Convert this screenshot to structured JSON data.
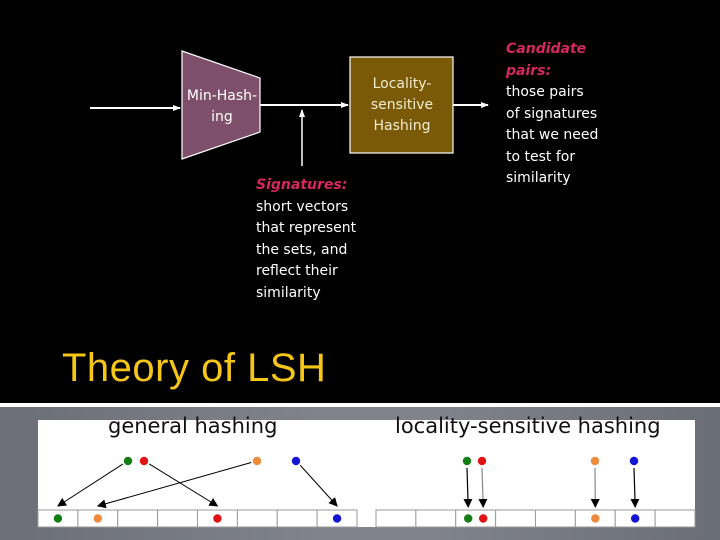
{
  "diagram": {
    "min_hashing_label_lines": [
      "Min-Hash-",
      "ing"
    ],
    "lsh_label_lines": [
      "Locality-",
      "sensitive",
      "Hashing"
    ],
    "colors": {
      "min_hashing_fill": "#7d4f6b",
      "lsh_fill": "#7a5a07",
      "highlight": "#d6275e",
      "title": "#f5c518"
    },
    "signatures_note": {
      "heading": "Signatures:",
      "lines": [
        "short vectors",
        "that represent",
        "the sets, and",
        "reflect their",
        "similarity"
      ]
    },
    "candidate_note": {
      "heading_lines": [
        "Candidate",
        "pairs:"
      ],
      "lines": [
        "those pairs",
        "of signatures",
        "that we need",
        "to test for",
        "similarity"
      ]
    }
  },
  "slide_title": "Theory of LSH",
  "illustration": {
    "general": {
      "caption": "general hashing",
      "items": [
        {
          "color": "green",
          "hex": "#137e13",
          "bucket": 0
        },
        {
          "color": "red",
          "hex": "#e01414",
          "bucket": 4
        },
        {
          "color": "orange",
          "hex": "#ee8a3c",
          "bucket": 1
        },
        {
          "color": "blue",
          "hex": "#1414d6",
          "bucket": 7
        }
      ],
      "bucket_count": 8
    },
    "lsh": {
      "caption": "locality-sensitive hashing",
      "items": [
        {
          "color": "green",
          "hex": "#137e13",
          "bucket": 2
        },
        {
          "color": "red",
          "hex": "#e01414",
          "bucket": 2
        },
        {
          "color": "orange",
          "hex": "#ee8a3c",
          "bucket": 5
        },
        {
          "color": "blue",
          "hex": "#1414d6",
          "bucket": 6
        }
      ],
      "bucket_count": 8
    }
  }
}
